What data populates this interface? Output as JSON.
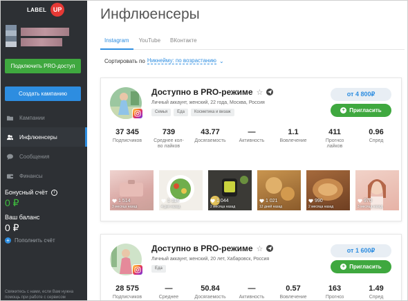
{
  "brand": {
    "logo_text": "LABEL",
    "logo_badge": "UP",
    "badge_color": "#e53935"
  },
  "sidebar": {
    "pro_button": "Подключить PRO-доступ",
    "create_button": "Создать кампанию",
    "nav": [
      {
        "label": "Кампании",
        "icon": "folder-icon",
        "active": false
      },
      {
        "label": "Инфлюенсеры",
        "icon": "people-icon",
        "active": true
      },
      {
        "label": "Сообщения",
        "icon": "chat-icon",
        "active": false
      },
      {
        "label": "Финансы",
        "icon": "wallet-icon",
        "active": false
      }
    ],
    "bonus_label": "Бонусный счёт",
    "bonus_value": "0 ₽",
    "balance_label": "Ваш баланс",
    "balance_value": "0 ₽",
    "topup_label": "Пополнить счёт",
    "footer_text": "Свяжитесь с нами, если Вам нужна помощь при работе с сервисом"
  },
  "main": {
    "title": "Инфлюенсеры",
    "tabs": [
      "Instagram",
      "YouTube",
      "ВКонтакте"
    ],
    "active_tab": "Instagram",
    "sort_label": "Сортировать по",
    "sort_value": "Никнейму: по возрастанию"
  },
  "colors": {
    "accent": "#2d8de0",
    "green": "#3fa83f",
    "sidebar_bg": "#2d3034"
  },
  "cards": [
    {
      "name": "Доступно в PRO-режиме",
      "subtitle": "Личный аккаунт, женский, 22 года, Москва, Россия",
      "tags": [
        "Семья",
        "Еда",
        "Косметика и визаж"
      ],
      "price": "от 4 800₽",
      "invite": "Пригласить",
      "stats": [
        {
          "value": "37 345",
          "label": "Подписчиков"
        },
        {
          "value": "739",
          "label": "Среднее кол-во лайков"
        },
        {
          "value": "43.77",
          "label": "Досягаемость"
        },
        {
          "value": "—",
          "label": "Активность"
        },
        {
          "value": "1.1",
          "label": "Вовлечение"
        },
        {
          "value": "411",
          "label": "Прогноз лайков"
        },
        {
          "value": "0.96",
          "label": "Спред"
        }
      ],
      "posts": [
        {
          "likes": "1 514",
          "date": "3 месяца назад"
        },
        {
          "likes": "1 114",
          "date": "4 дня назад"
        },
        {
          "likes": "1 044",
          "date": "2 месяца назад"
        },
        {
          "likes": "1 021",
          "date": "12 дней назад"
        },
        {
          "likes": "990",
          "date": "2 месяца назад"
        },
        {
          "likes": "970",
          "date": "3 месяца назад"
        }
      ]
    },
    {
      "name": "Доступно в PRO-режиме",
      "subtitle": "Личный аккаунт, женский, 20 лет, Хабаровск, Россия",
      "tags": [
        "Еда"
      ],
      "price": "от 1 600₽",
      "invite": "Пригласить",
      "stats": [
        {
          "value": "28 575",
          "label": "Подписчиков"
        },
        {
          "value": "—",
          "label": "Среднее"
        },
        {
          "value": "50.84",
          "label": "Досягаемость"
        },
        {
          "value": "—",
          "label": "Активность"
        },
        {
          "value": "0.57",
          "label": "Вовлечение"
        },
        {
          "value": "163",
          "label": "Прогноз"
        },
        {
          "value": "1.49",
          "label": "Спред"
        }
      ]
    }
  ]
}
